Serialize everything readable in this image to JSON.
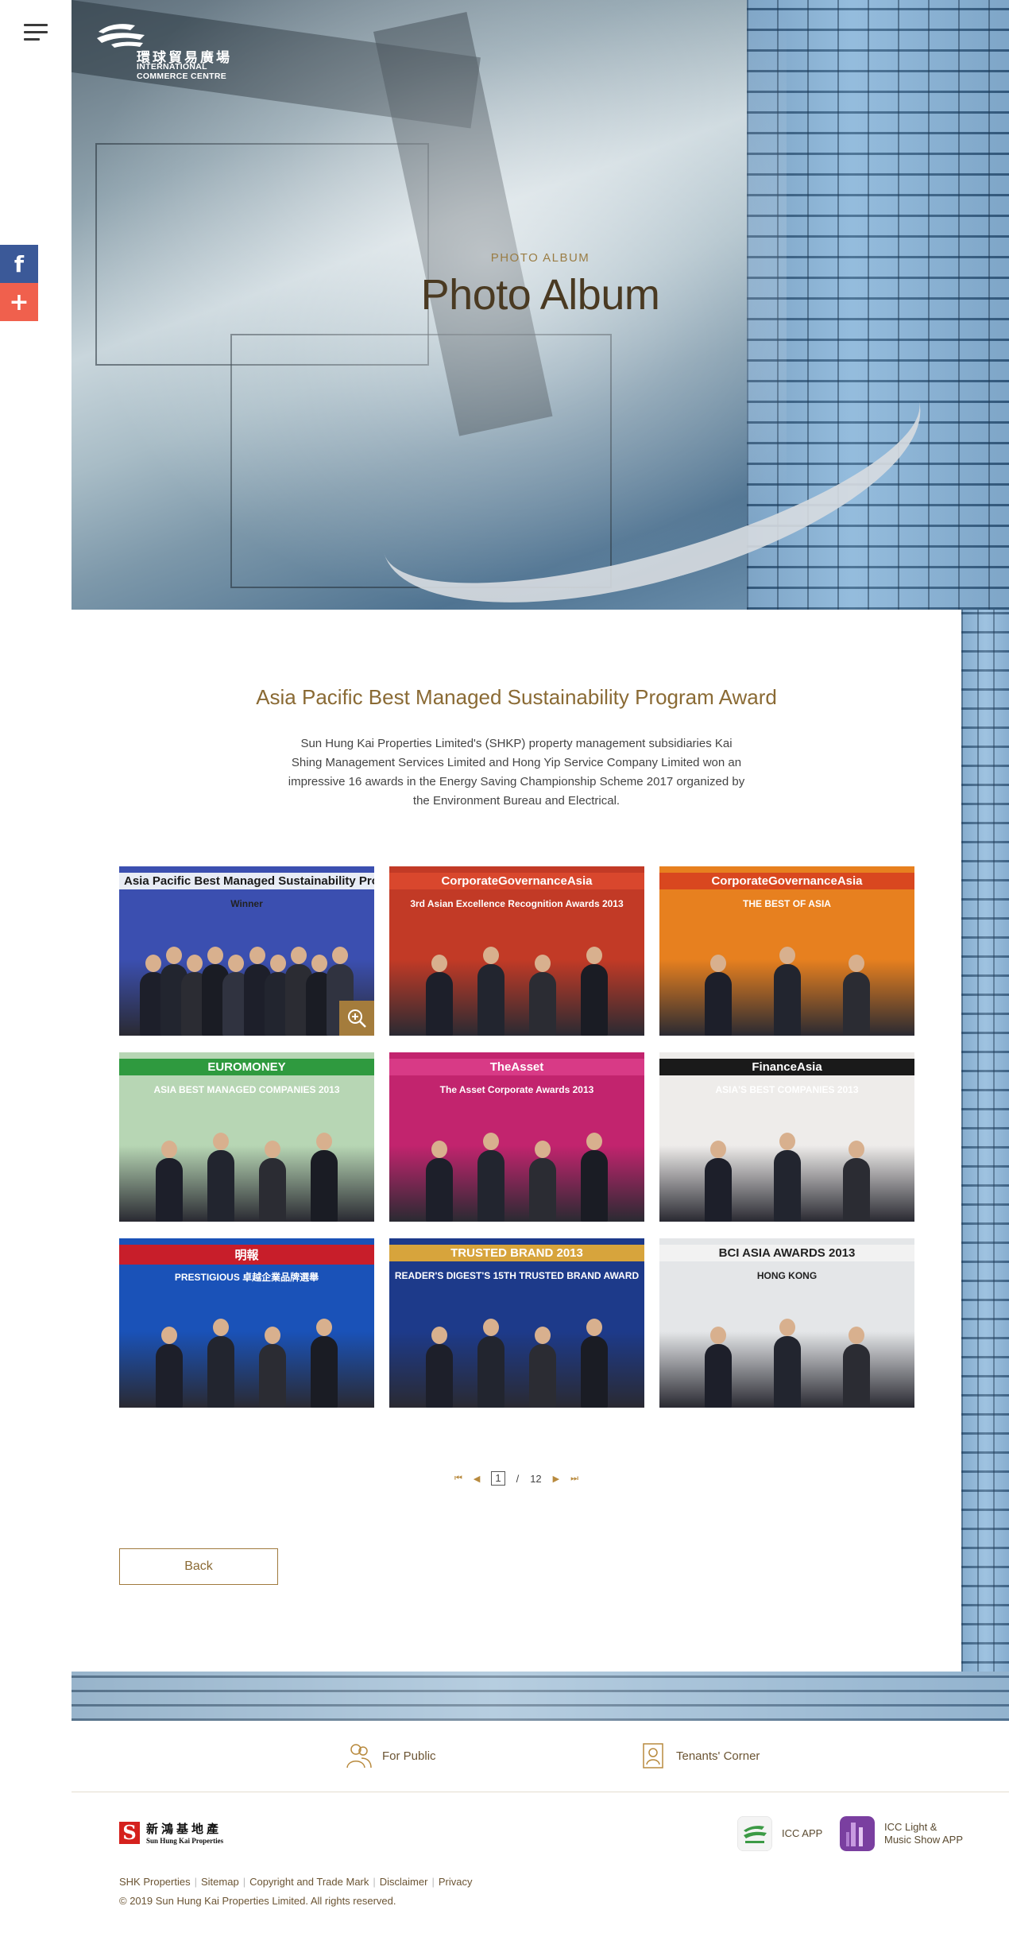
{
  "header": {
    "logo_cn": "環球貿易廣場",
    "logo_en_line1": "INTERNATIONAL",
    "logo_en_line2": "COMMERCE CENTRE"
  },
  "social": {
    "facebook": "f",
    "share": "+"
  },
  "hero": {
    "eyebrow": "PHOTO ALBUM",
    "title": "Photo Album"
  },
  "album": {
    "title": "Asia Pacific Best Managed Sustainability Program Award",
    "description": "Sun Hung Kai Properties Limited's (SHKP) property management subsidiaries Kai Shing Management Services Limited and Hong Yip Service Company Limited won an impressive 16 awards in the Energy Saving Championship Scheme 2017 organized by the Environment Bureau and Electrical.",
    "photos": [
      {
        "banner": "Asia Pacific Best Managed Sustainability Program Award",
        "sub": "Winner",
        "bg": "#3b4fb0",
        "banner_color": "#1a1a1a",
        "banner_bg": "#e8ecf5"
      },
      {
        "banner": "CorporateGovernanceAsia",
        "sub": "3rd Asian Excellence Recognition Awards 2013",
        "bg": "#c23a26",
        "banner_color": "#ffffff",
        "banner_bg": "#d9472d"
      },
      {
        "banner": "CorporateGovernanceAsia",
        "sub": "THE BEST OF ASIA",
        "bg": "#e7801f",
        "banner_color": "#ffffff",
        "banner_bg": "#d9471f"
      },
      {
        "banner": "EUROMONEY",
        "sub": "ASIA BEST MANAGED COMPANIES 2013",
        "bg": "#b7d6b4",
        "banner_color": "#ffffff",
        "banner_bg": "#2f9a3f"
      },
      {
        "banner": "TheAsset",
        "sub": "The Asset Corporate Awards 2013",
        "bg": "#c2246e",
        "banner_color": "#ffffff",
        "banner_bg": "#d83a86"
      },
      {
        "banner": "FinanceAsia",
        "sub": "ASIA'S BEST COMPANIES 2013",
        "bg": "#eeecea",
        "banner_color": "#ffffff",
        "banner_bg": "#1a1a1a"
      },
      {
        "banner": "明報",
        "sub": "PRESTIGIOUS 卓越企業品牌選舉",
        "bg": "#1a52b8",
        "banner_color": "#ffffff",
        "banner_bg": "#c81e2a"
      },
      {
        "banner": "TRUSTED BRAND 2013",
        "sub": "READER'S DIGEST'S 15TH TRUSTED BRAND AWARD",
        "bg": "#1d3a8a",
        "banner_color": "#ffffff",
        "banner_bg": "#d7a43c"
      },
      {
        "banner": "BCI ASIA AWARDS 2013",
        "sub": "HONG KONG",
        "bg": "#e4e6e8",
        "banner_color": "#222222",
        "banner_bg": "#f2f2f2"
      }
    ]
  },
  "pagination": {
    "first": "⏮",
    "prev": "◀",
    "current": "1",
    "separator": "/",
    "total": "12",
    "next": "▶",
    "last": "⏭"
  },
  "back_label": "Back",
  "footer": {
    "for_public": "For Public",
    "tenants_corner": "Tenants' Corner",
    "shk_cn": "新鴻基地產",
    "shk_en": "Sun Hung Kai Properties",
    "shk_mark": "S",
    "icc_app": "ICC APP",
    "light_app_line1": "ICC Light &",
    "light_app_line2": "Music Show APP",
    "links": [
      "SHK Properties",
      "Sitemap",
      "Copyright and Trade Mark",
      "Disclaimer",
      "Privacy"
    ],
    "copyright": "© 2019 Sun Hung Kai Properties Limited. All rights reserved."
  },
  "colors": {
    "accent": "#8a6a34",
    "facebook": "#3b5998",
    "share": "#f0604d"
  }
}
